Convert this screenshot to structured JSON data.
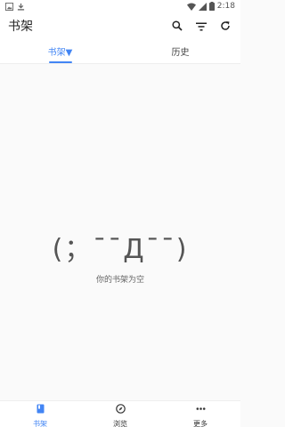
{
  "status": {
    "time": "2:18",
    "accent": "#4285f4"
  },
  "appbar": {
    "title": "书架"
  },
  "tabs": [
    {
      "label": "书架▼",
      "active": true
    },
    {
      "label": "历史",
      "active": false
    }
  ],
  "empty": {
    "kaomoji": "(；¯¯Д¯¯)",
    "message": "你的书架为空"
  },
  "bottom_nav": [
    {
      "label": "书架",
      "icon": "book-icon",
      "active": true
    },
    {
      "label": "浏览",
      "icon": "compass-icon",
      "active": false
    },
    {
      "label": "更多",
      "icon": "more-icon",
      "active": false
    }
  ]
}
